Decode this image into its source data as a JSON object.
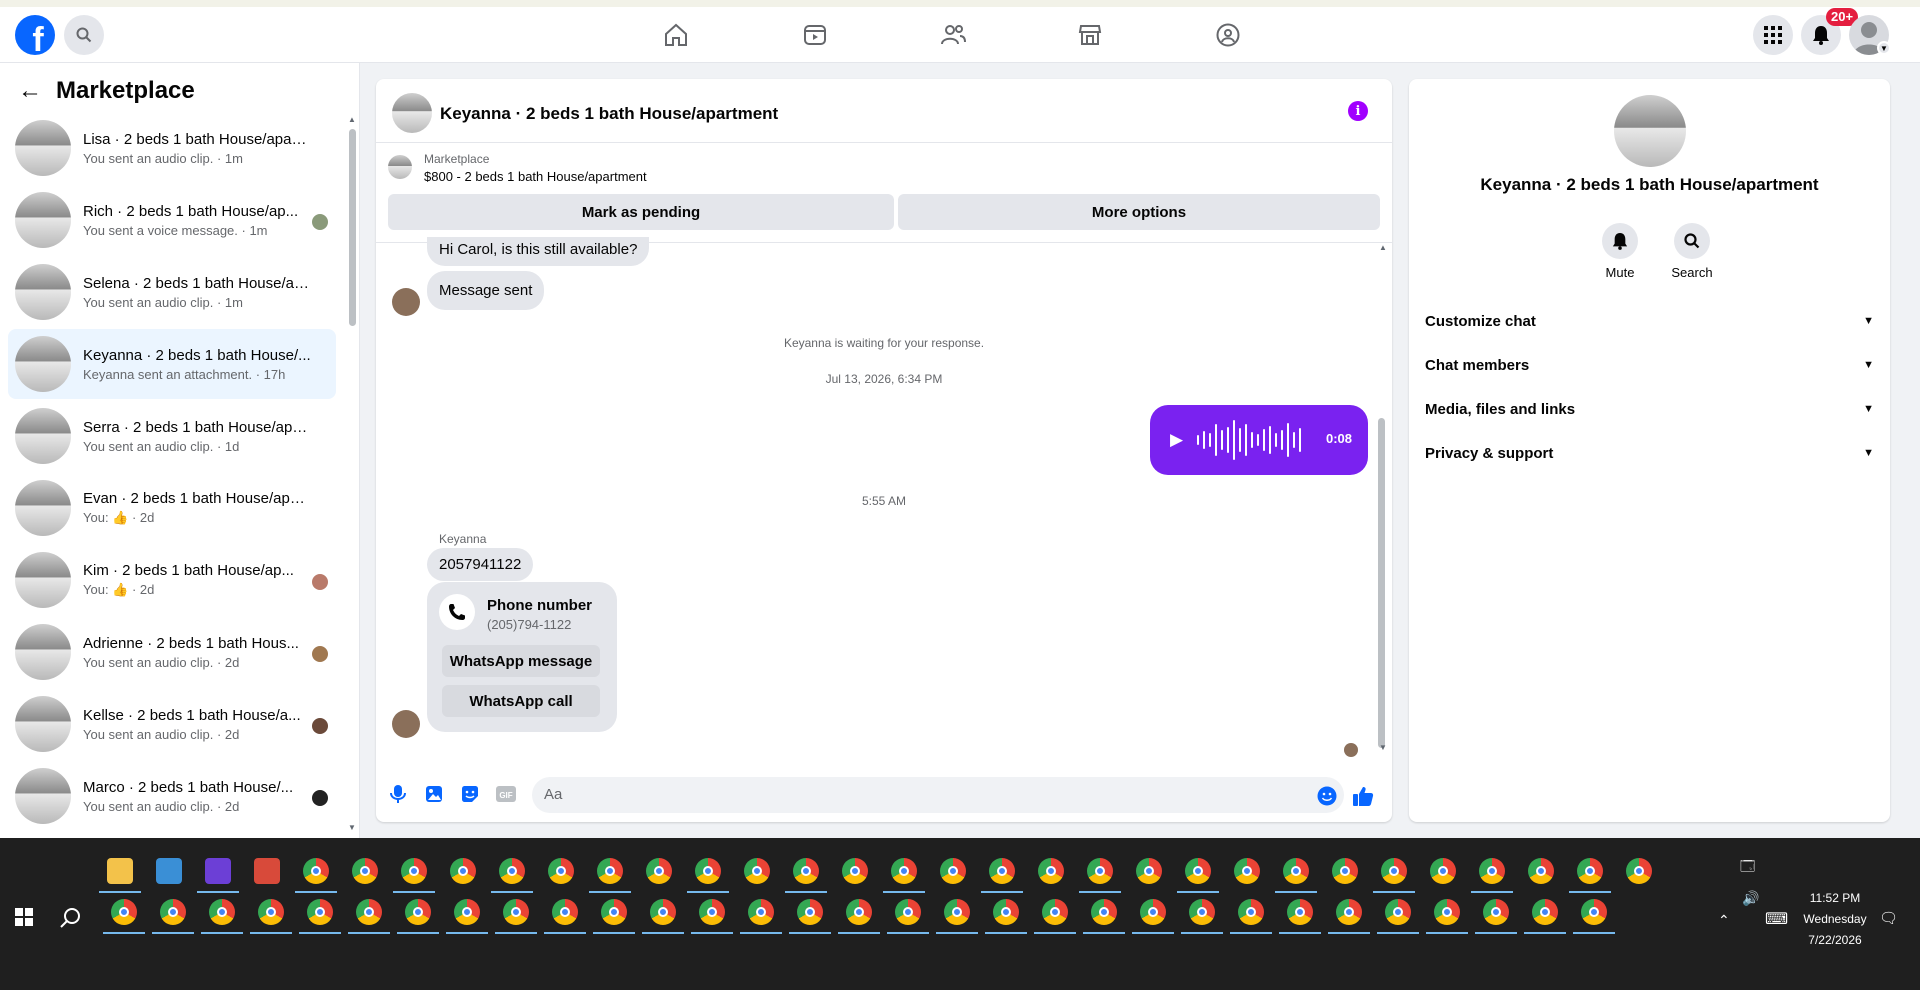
{
  "topbar": {
    "logo": "f",
    "notif_badge": "20+",
    "nav_icons": [
      "home-icon",
      "video-icon",
      "friends-icon",
      "marketplace-icon",
      "groups-icon"
    ]
  },
  "sidebar": {
    "title": "Marketplace",
    "conversations": [
      {
        "name": "Lisa · 2 beds 1 bath House/apart...",
        "sub": "You sent an audio clip. · 1m"
      },
      {
        "name": "Rich · 2 beds 1 bath House/ap...",
        "sub": "You sent a voice message. · 1m"
      },
      {
        "name": "Selena · 2 beds 1 bath House/ap...",
        "sub": "You sent an audio clip. · 1m"
      },
      {
        "name": "Keyanna · 2 beds 1 bath House/...",
        "sub": "Keyanna sent an attachment. · 17h"
      },
      {
        "name": "Serra · 2 beds 1 bath House/apa...",
        "sub": "You sent an audio clip. · 1d"
      },
      {
        "name": "Evan · 2 beds 1 bath House/apar...",
        "sub": "You: 👍 · 2d"
      },
      {
        "name": "Kim · 2 beds 1 bath House/ap...",
        "sub": "You: 👍 · 2d"
      },
      {
        "name": "Adrienne · 2 beds 1 bath Hous...",
        "sub": "You sent an audio clip. · 2d"
      },
      {
        "name": "Kellse · 2 beds 1 bath House/a...",
        "sub": "You sent an audio clip. · 2d"
      },
      {
        "name": "Marco · 2 beds 1 bath House/...",
        "sub": "You sent an audio clip. · 2d"
      }
    ]
  },
  "chat": {
    "title": "Keyanna · 2 beds 1 bath House/apartment",
    "marketplace_label": "Marketplace",
    "listing": "$800 - 2 beds 1 bath House/apartment",
    "pending_btn": "Mark as pending",
    "more_btn": "More options",
    "msg1": "Hi Carol, is this still available?",
    "msg2": "Message sent",
    "waiting": "Keyanna is waiting for your response.",
    "timestamp1": "Jul 13, 2026, 6:34 PM",
    "audio_duration": "0:08",
    "timestamp2": "5:55 AM",
    "sender": "Keyanna",
    "number_msg": "2057941122",
    "phone_title": "Phone number",
    "phone_value": "(205)794-1122",
    "whatsapp_message": "WhatsApp message",
    "whatsapp_call": "WhatsApp call",
    "input_placeholder": "Aa"
  },
  "rpanel": {
    "title": "Keyanna · 2 beds 1 bath House/apartment",
    "mute": "Mute",
    "search": "Search",
    "rows": [
      "Customize chat",
      "Chat members",
      "Media, files and links",
      "Privacy & support"
    ]
  },
  "taskbar": {
    "time": "11:52 PM",
    "day": "Wednesday",
    "date": "7/22/2026"
  },
  "colors": {
    "brand": "#0866ff",
    "accent": "#7a22f0",
    "info": "#a100ff"
  }
}
